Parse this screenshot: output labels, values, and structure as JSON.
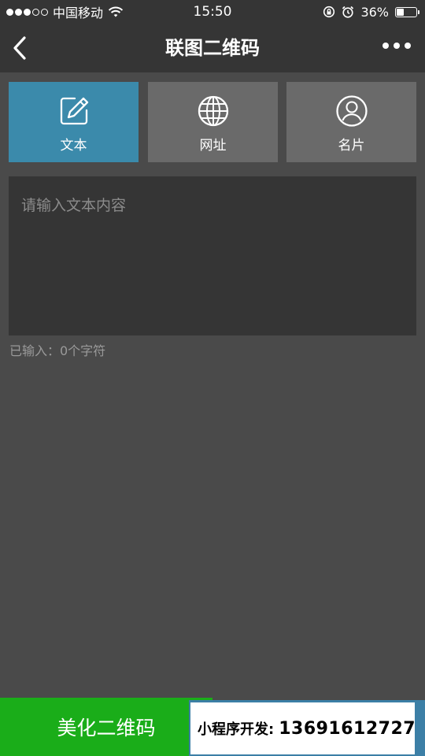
{
  "status_bar": {
    "carrier": "中国移动",
    "time": "15:50",
    "battery_percent_text": "36%",
    "battery_level": 0.36
  },
  "nav": {
    "title": "联图二维码"
  },
  "tabs": [
    {
      "label": "文本",
      "icon": "edit-icon",
      "active": true
    },
    {
      "label": "网址",
      "icon": "globe-icon",
      "active": false
    },
    {
      "label": "名片",
      "icon": "user-icon",
      "active": false
    }
  ],
  "input": {
    "placeholder": "请输入文本内容",
    "value": ""
  },
  "counter": {
    "text": "已输入：0个字符"
  },
  "bottom": {
    "beautify_label": "美化二维码",
    "promo_label": "小程序开发:",
    "promo_phone": "13691612727"
  },
  "colors": {
    "background": "#4a4a4a",
    "bar": "#353535",
    "tab_active": "#3b8aab",
    "tab_inactive": "#6a6a6a",
    "primary_button": "#1aad19"
  }
}
